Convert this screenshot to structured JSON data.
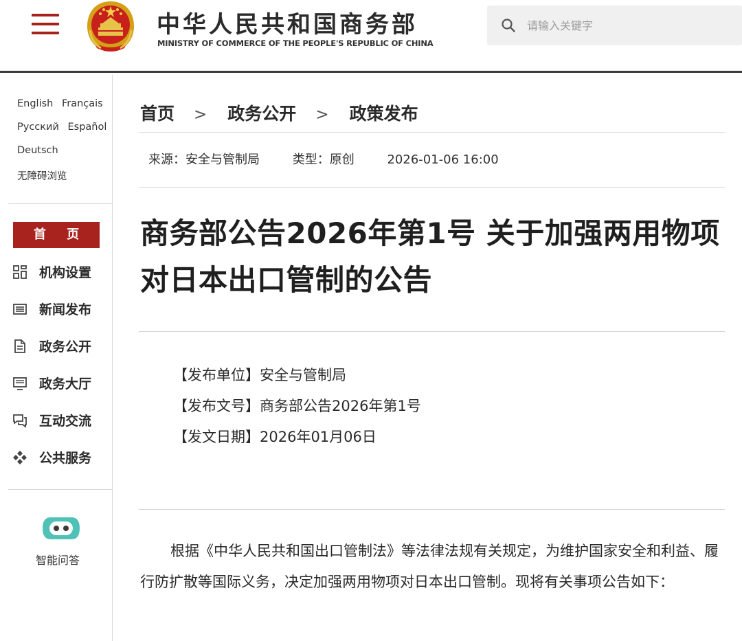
{
  "header": {
    "title": "中华人民共和国商务部",
    "subtitle": "MINISTRY OF COMMERCE OF THE PEOPLE'S REPUBLIC OF CHINA",
    "search_placeholder": "请输入关键字"
  },
  "sidebar": {
    "languages": [
      "English",
      "Français",
      "Русский",
      "Español",
      "Deutsch"
    ],
    "accessibility": "无障碍浏览",
    "home_label": "首 页",
    "nav_items": [
      {
        "label": "机构设置",
        "icon": "grid-icon"
      },
      {
        "label": "新闻发布",
        "icon": "news-icon"
      },
      {
        "label": "政务公开",
        "icon": "document-icon"
      },
      {
        "label": "政务大厅",
        "icon": "monitor-icon"
      },
      {
        "label": "互动交流",
        "icon": "chat-icon"
      },
      {
        "label": "公共服务",
        "icon": "service-icon"
      }
    ],
    "assistant_label": "智能问答"
  },
  "breadcrumb": {
    "items": [
      "首页",
      "政务公开",
      "政策发布"
    ],
    "separator": ">"
  },
  "meta": {
    "source": "来源：安全与管制局",
    "type": "类型：原创",
    "datetime": "2026-01-06 16:00"
  },
  "article": {
    "title": "商务部公告2026年第1号 关于加强两用物项对日本出口管制的公告",
    "info": [
      "【发布单位】安全与管制局",
      "【发布文号】商务部公告2026年第1号",
      "【发文日期】2026年01月06日"
    ],
    "body": "根据《中华人民共和国出口管制法》等法律法规有关规定，为维护国家安全和利益、履行防扩散等国际义务，决定加强两用物项对日本出口管制。现将有关事项公告如下："
  },
  "colors": {
    "accent_red": "#a8231d",
    "header_rule": "#3a3a3a",
    "assistant_teal": "#4fc2b8"
  }
}
